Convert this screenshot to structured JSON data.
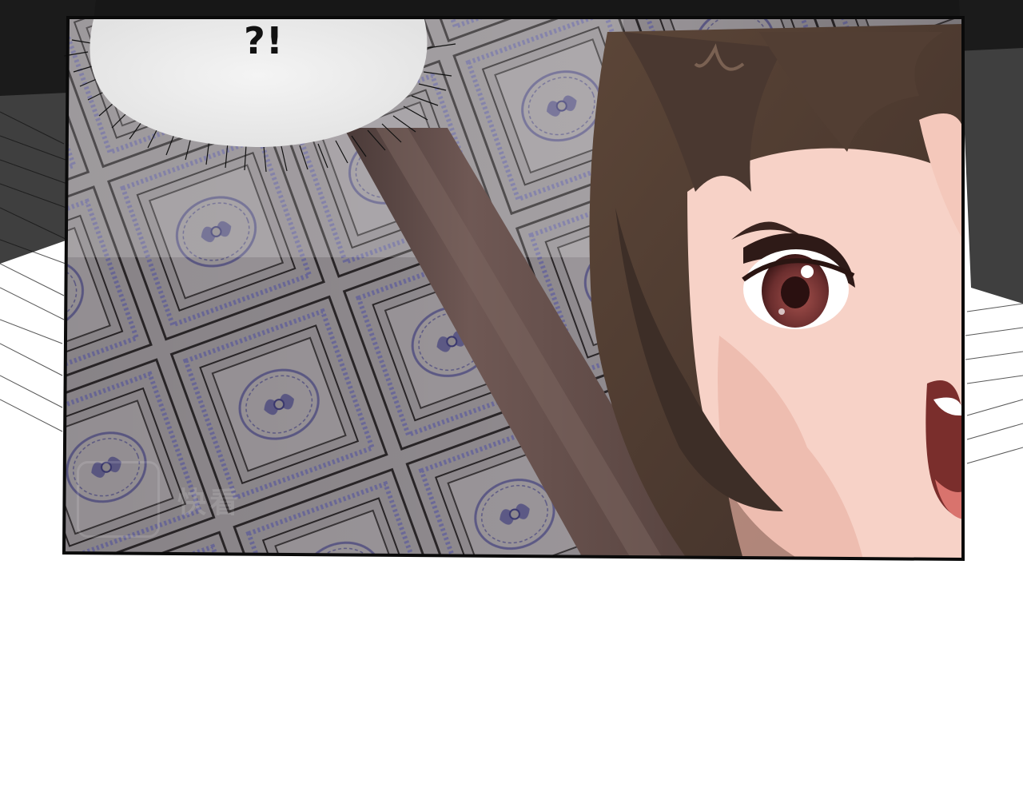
{
  "speech_bubble": {
    "text": "?!"
  },
  "watermark": {
    "text": "快看"
  },
  "colors": {
    "ink": "#111111",
    "ceiling": "#8f8a8e",
    "ornament": "#5d5a86",
    "beam": "#6a5450",
    "hair": "#4f3c32",
    "skin": "#f7d2c7",
    "iris": "#6b2e2e"
  }
}
